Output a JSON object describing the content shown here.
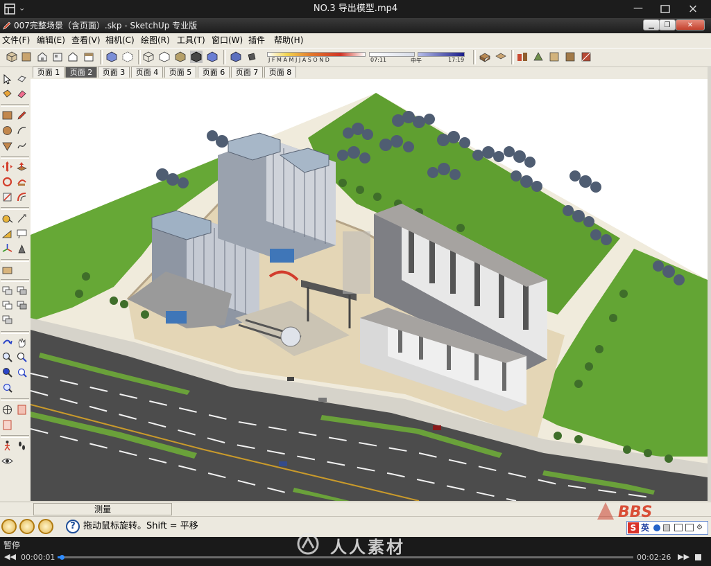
{
  "player": {
    "title": "NO.3  导出模型.mp4",
    "state": "暂停",
    "time_current": "00:00:01",
    "time_total": "00:02:26",
    "progress": 0.007
  },
  "window": {
    "title": "007完整场景（含页面）.skp - SketchUp 专业版"
  },
  "menu": [
    "文件(F)",
    "编辑(E)",
    "查看(V)",
    "相机(C)",
    "绘图(R)",
    "工具(T)",
    "窗口(W)",
    "插件",
    "帮助(H)"
  ],
  "shadow_settings": {
    "months": "J F M A M J J A S O N D",
    "time_start": "07:11",
    "time_mid": "中午",
    "time_end": "17:19"
  },
  "pages": {
    "tabs": [
      "页面 1",
      "页面 2",
      "页面 3",
      "页面 4",
      "页面 5",
      "页面 6",
      "页面 7",
      "页面 8"
    ],
    "active": "页面 2"
  },
  "status": {
    "measure_label": "测量",
    "hint": "拖动鼠标旋转。Shift = 平移"
  },
  "ime": {
    "label": "英"
  },
  "watermark": {
    "text": "人人素材"
  },
  "colors": {
    "grass": "#62a533",
    "road": "#4b4b4b",
    "plaza": "#e3d5b7",
    "accent_red": "#c7321e"
  }
}
